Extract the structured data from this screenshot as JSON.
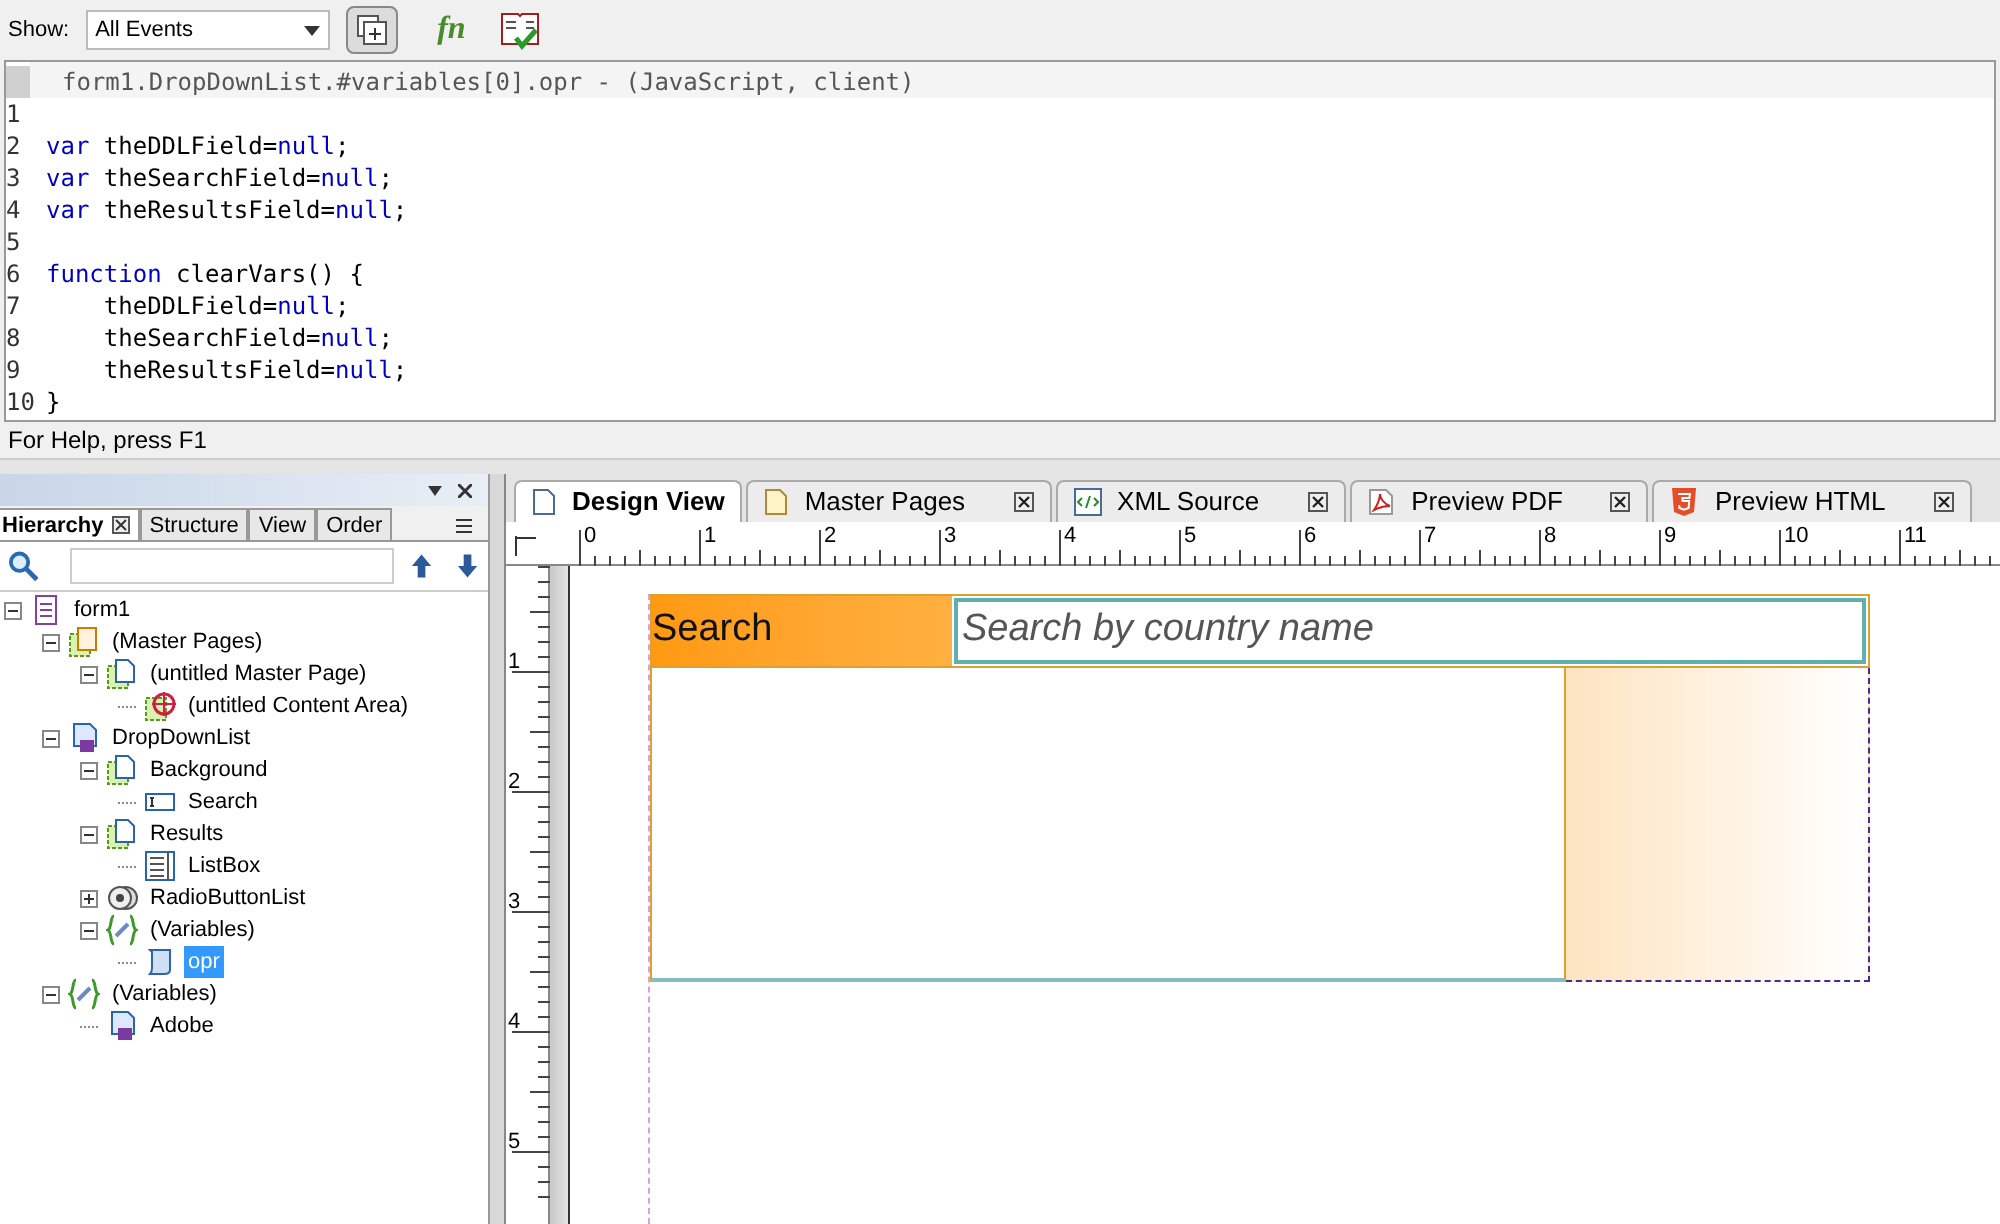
{
  "toolbar": {
    "show_label": "Show:",
    "show_value": "All Events",
    "fn_label": "fn"
  },
  "script_editor": {
    "header": "form1.DropDownList.#variables[0].opr - (JavaScript, client)",
    "lines": [
      {
        "number": "1"
      },
      {
        "number": "2",
        "segments": [
          {
            "kind": "keyword",
            "text": "var"
          },
          {
            "kind": "plain",
            "text": " theDDLField="
          },
          {
            "kind": "keyword",
            "text": "null"
          },
          {
            "kind": "plain",
            "text": ";"
          }
        ]
      },
      {
        "number": "3",
        "segments": [
          {
            "kind": "keyword",
            "text": "var"
          },
          {
            "kind": "plain",
            "text": " theSearchField="
          },
          {
            "kind": "keyword",
            "text": "null"
          },
          {
            "kind": "plain",
            "text": ";"
          }
        ]
      },
      {
        "number": "4",
        "segments": [
          {
            "kind": "keyword",
            "text": "var"
          },
          {
            "kind": "plain",
            "text": " theResultsField="
          },
          {
            "kind": "keyword",
            "text": "null"
          },
          {
            "kind": "plain",
            "text": ";"
          }
        ]
      },
      {
        "number": "5"
      },
      {
        "number": "6",
        "segments": [
          {
            "kind": "keyword",
            "text": "function"
          },
          {
            "kind": "plain",
            "text": " clearVars() {"
          }
        ]
      },
      {
        "number": "7",
        "segments": [
          {
            "kind": "plain",
            "text": "    theDDLField="
          },
          {
            "kind": "keyword",
            "text": "null"
          },
          {
            "kind": "plain",
            "text": ";"
          }
        ]
      },
      {
        "number": "8",
        "segments": [
          {
            "kind": "plain",
            "text": "    theSearchField="
          },
          {
            "kind": "keyword",
            "text": "null"
          },
          {
            "kind": "plain",
            "text": ";"
          }
        ]
      },
      {
        "number": "9",
        "segments": [
          {
            "kind": "plain",
            "text": "    theResultsField="
          },
          {
            "kind": "keyword",
            "text": "null"
          },
          {
            "kind": "plain",
            "text": ";"
          }
        ]
      },
      {
        "number": "10",
        "segments": [
          {
            "kind": "plain",
            "text": "}"
          }
        ]
      }
    ]
  },
  "status_bar": {
    "text": "For Help, press F1"
  },
  "hierarchy_panel": {
    "tabs": [
      {
        "label": "Hierarchy",
        "selected": true
      },
      {
        "label": "Structure",
        "selected": false
      },
      {
        "label": "View",
        "selected": false
      },
      {
        "label": "Order",
        "selected": false
      }
    ],
    "tree": [
      {
        "label": "form1",
        "kind": "form",
        "expanded": true,
        "selected": false,
        "children": [
          {
            "label": "(Master Pages)",
            "kind": "masterpages",
            "expanded": true,
            "selected": false,
            "children": [
              {
                "label": "(untitled Master Page)",
                "kind": "page",
                "expanded": true,
                "selected": false,
                "children": [
                  {
                    "label": "(untitled Content Area)",
                    "kind": "contentarea",
                    "selected": false
                  }
                ]
              }
            ]
          },
          {
            "label": "DropDownList",
            "kind": "subform",
            "expanded": true,
            "selected": false,
            "children": [
              {
                "label": "Background",
                "kind": "page",
                "expanded": true,
                "selected": false,
                "children": [
                  {
                    "label": "Search",
                    "kind": "textfield",
                    "selected": false
                  }
                ]
              },
              {
                "label": "Results",
                "kind": "page",
                "expanded": true,
                "selected": false,
                "children": [
                  {
                    "label": "ListBox",
                    "kind": "listbox",
                    "selected": false
                  }
                ]
              },
              {
                "label": "RadioButtonList",
                "kind": "radiolist",
                "expanded": false,
                "selected": false
              },
              {
                "label": "(Variables)",
                "kind": "variables",
                "expanded": true,
                "selected": false,
                "children": [
                  {
                    "label": "opr",
                    "kind": "script",
                    "selected": true
                  }
                ]
              }
            ]
          },
          {
            "label": "(Variables)",
            "kind": "variables",
            "expanded": true,
            "selected": false,
            "children": [
              {
                "label": "Adobe",
                "kind": "subform",
                "selected": false
              }
            ]
          }
        ]
      }
    ]
  },
  "editor_tabs": [
    {
      "label": "Design View",
      "kind": "design",
      "selected": true,
      "closable": false
    },
    {
      "label": "Master Pages",
      "kind": "master",
      "selected": false,
      "closable": true
    },
    {
      "label": "XML Source",
      "kind": "xml",
      "selected": false,
      "closable": true
    },
    {
      "label": "Preview PDF",
      "kind": "pdf",
      "selected": false,
      "closable": true
    },
    {
      "label": "Preview HTML",
      "kind": "html",
      "selected": false,
      "closable": true
    }
  ],
  "rulers": {
    "horizontal": [
      "0",
      "1",
      "2",
      "3",
      "4",
      "5",
      "6",
      "7",
      "8",
      "9",
      "10",
      "11"
    ],
    "vertical": [
      "1",
      "2",
      "3",
      "4",
      "5"
    ]
  },
  "design": {
    "search_label": "Search",
    "search_placeholder": "Search by country name"
  }
}
